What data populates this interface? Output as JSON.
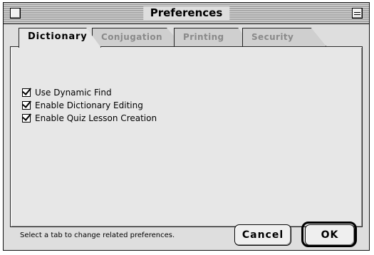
{
  "window": {
    "title": "Preferences"
  },
  "tabs": [
    {
      "label": "Dictionary",
      "active": true
    },
    {
      "label": "Conjugation",
      "active": false
    },
    {
      "label": "Printing",
      "active": false
    },
    {
      "label": "Security",
      "active": false
    }
  ],
  "options": [
    {
      "label": "Use Dynamic Find",
      "checked": true
    },
    {
      "label": "Enable Dictionary Editing",
      "checked": true
    },
    {
      "label": "Enable Quiz Lesson Creation",
      "checked": true
    }
  ],
  "status_text": "Select a tab to change related preferences.",
  "buttons": {
    "cancel_label": "Cancel",
    "ok_label": "OK"
  }
}
